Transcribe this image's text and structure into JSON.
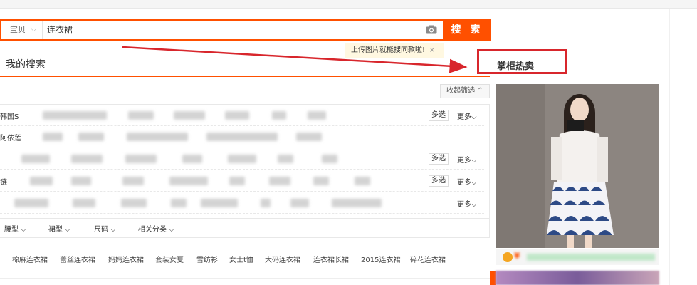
{
  "search": {
    "type_label": "宝贝",
    "query": "连衣裙",
    "button_label": "搜 索"
  },
  "tooltip": {
    "text": "上传图片就能搜同款啦!",
    "close": "×"
  },
  "my_search_title": "我的搜索",
  "hot_title": "掌柜热卖",
  "collapse_label": "收起筛选 ⌃",
  "filter_rows": [
    {
      "label": "韩国S",
      "has_multi": true
    },
    {
      "label": "阿依莲",
      "has_multi": false
    },
    {
      "label": "",
      "has_multi": true
    },
    {
      "label": "链",
      "has_multi": true
    },
    {
      "label": "",
      "has_multi": false
    }
  ],
  "multi_label": "多选",
  "more_label": "更多",
  "attrs": [
    "腰型",
    "裙型",
    "尺码",
    "相关分类"
  ],
  "related": [
    "棉麻连衣裙",
    "蕾丝连衣裙",
    "妈妈连衣裙",
    "套装女夏",
    "雪纺衫",
    "女士t恤",
    "大码连衣裙",
    "连衣裙长裙",
    "2015连衣裙",
    "碎花连衣裙"
  ],
  "price_prefix": "¥",
  "colors": {
    "accent": "#ff5000",
    "highlight_box": "#d8262c"
  }
}
